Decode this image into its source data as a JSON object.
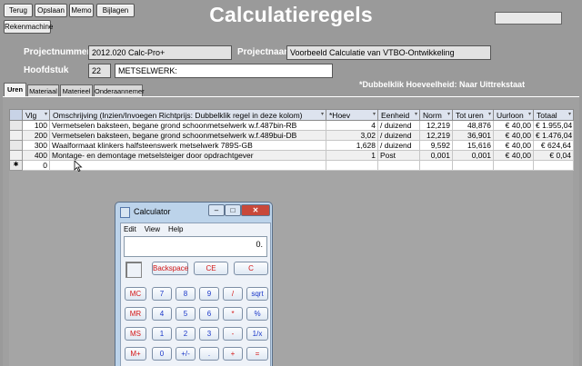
{
  "toolbar": {
    "terug": "Terug",
    "opslaan": "Opslaan",
    "memo": "Memo",
    "bijlagen": "Bijlagen",
    "rekenmachine": "Rekenmachine"
  },
  "title": "Calculatieregels",
  "project": {
    "nummer_label": "Projectnummer",
    "nummer_value": "2012.020 Calc-Pro+",
    "naam_label": "Projectnaam",
    "naam_value": "Voorbeeld Calculatie van VTBO-Ontwikkeling",
    "hoofdstuk_label": "Hoofdstuk",
    "hoofdstuk_nr": "22",
    "hoofdstuk_value": "METSELWERK:"
  },
  "hint": "*Dubbelklik Hoeveelheid: Naar Uittrekstaat",
  "tabs": [
    "Uren",
    "Materiaal",
    "Materieel",
    "Onderaannemer"
  ],
  "grid": {
    "columns": [
      "Vlg",
      "Omschrijving (Inzien/Invoegen Richtprijs: Dubbelklik regel in deze kolom)",
      "*Hoev",
      "Eenheid",
      "Norm",
      "Tot uren",
      "Uurloon",
      "Totaal"
    ],
    "rows": [
      [
        "100",
        "Vermetselen baksteen, begane grond schoonmetselwerk w.f.487bin-RB",
        "4",
        "/ duizend",
        "12,219",
        "48,876",
        "€ 40,00",
        "€ 1.955,04"
      ],
      [
        "200",
        "Vermetselen baksteen, begane grond schoonmetselwerk w.f.489bui-DB",
        "3,02",
        "/ duizend",
        "12,219",
        "36,901",
        "€ 40,00",
        "€ 1.476,04"
      ],
      [
        "300",
        "Waalformaat klinkers halfsteenswerk metselwerk 789S-GB",
        "1,628",
        "/ duizend",
        "9,592",
        "15,616",
        "€ 40,00",
        "€ 624,64"
      ],
      [
        "400",
        "Montage- en demontage metselsteiger door opdrachtgever",
        "1",
        "Post",
        "0,001",
        "0,001",
        "€ 40,00",
        "€ 0,04"
      ]
    ],
    "new_row_vlg": "0",
    "new_row_marker": "✱"
  },
  "calculator": {
    "title": "Calculator",
    "menu": [
      "Edit",
      "View",
      "Help"
    ],
    "display": "0.",
    "top_keys": [
      "Backspace",
      "CE",
      "C"
    ],
    "rows": [
      [
        "MC",
        "7",
        "8",
        "9",
        "/",
        "sqrt"
      ],
      [
        "MR",
        "4",
        "5",
        "6",
        "*",
        "%"
      ],
      [
        "MS",
        "1",
        "2",
        "3",
        "-",
        "1/x"
      ],
      [
        "M+",
        "0",
        "+/-",
        ".",
        "+",
        "="
      ]
    ]
  }
}
